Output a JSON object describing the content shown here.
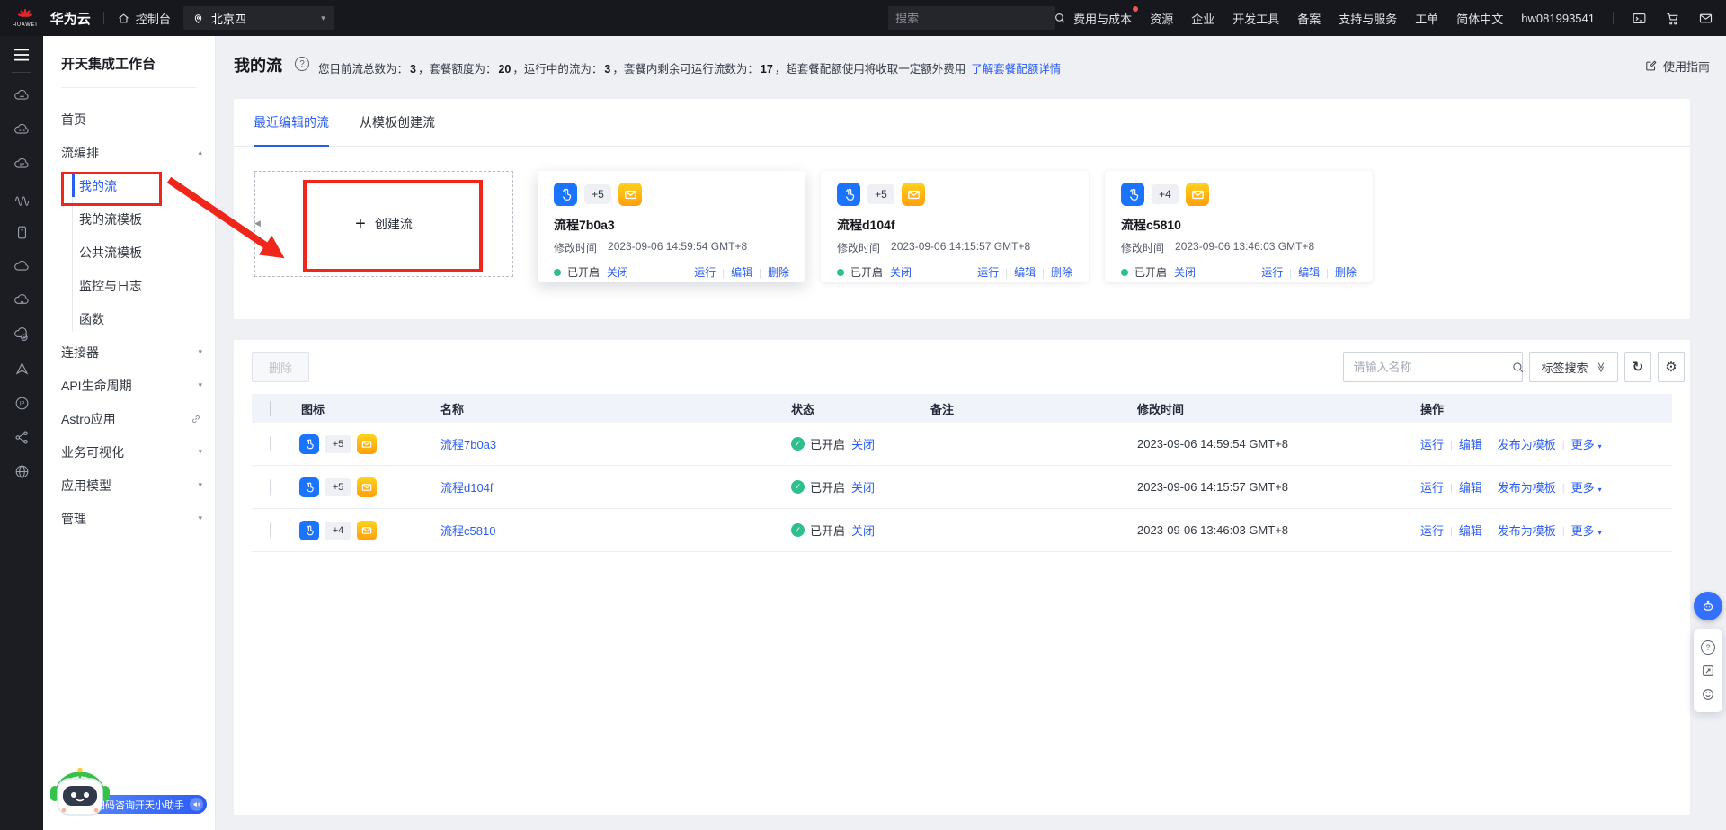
{
  "topnav": {
    "brand": "华为云",
    "console": "控制台",
    "region": "北京四",
    "search_placeholder": "搜索",
    "links": [
      {
        "label": "费用与成本",
        "badge": true
      },
      {
        "label": "资源"
      },
      {
        "label": "企业"
      },
      {
        "label": "开发工具"
      },
      {
        "label": "备案"
      },
      {
        "label": "支持与服务"
      },
      {
        "label": "工单"
      },
      {
        "label": "简体中文"
      }
    ],
    "username": "hw081993541"
  },
  "sidebar": {
    "title": "开天集成工作台",
    "home": "首页",
    "groups": {
      "flow": {
        "label": "流编排",
        "children": [
          {
            "label": "我的流",
            "active": true
          },
          {
            "label": "我的流模板"
          },
          {
            "label": "公共流模板"
          },
          {
            "label": "监控与日志"
          },
          {
            "label": "函数"
          }
        ]
      },
      "connector": "连接器",
      "api": "API生命周期",
      "astro": "Astro应用",
      "bizvis": "业务可视化",
      "appmodel": "应用模型",
      "manage": "管理"
    }
  },
  "page": {
    "title": "我的流",
    "desc": {
      "p1": "您目前流总数为：",
      "v1": "3",
      "p2": "，套餐额度为：",
      "v2": "20",
      "p3": "，运行中的流为：",
      "v3": "3",
      "p4": "，套餐内剩余可运行流数为：",
      "v4": "17",
      "p5": "，超套餐配额使用将收取一定额外费用",
      "link": "了解套餐配额详情"
    },
    "guide": "使用指南"
  },
  "tabs": {
    "recent": "最近编辑的流",
    "from_template": "从模板创建流"
  },
  "create_card": {
    "label": "创建流"
  },
  "cards": [
    {
      "name": "流程7b0a3",
      "badge": "+5",
      "modified_label": "修改时间",
      "modified": "2023-09-06 14:59:54 GMT+8",
      "status": "已开启",
      "toggle": "关闭",
      "run": "运行",
      "edit": "编辑",
      "del": "删除"
    },
    {
      "name": "流程d104f",
      "badge": "+5",
      "modified_label": "修改时间",
      "modified": "2023-09-06 14:15:57 GMT+8",
      "status": "已开启",
      "toggle": "关闭",
      "run": "运行",
      "edit": "编辑",
      "del": "删除"
    },
    {
      "name": "流程c5810",
      "badge": "+4",
      "modified_label": "修改时间",
      "modified": "2023-09-06 13:46:03 GMT+8",
      "status": "已开启",
      "toggle": "关闭",
      "run": "运行",
      "edit": "编辑",
      "del": "删除"
    }
  ],
  "table": {
    "delete_button": "删除",
    "search_placeholder": "请输入名称",
    "tag_search": "标签搜索",
    "columns": {
      "icon": "图标",
      "name": "名称",
      "status": "状态",
      "remark": "备注",
      "modified": "修改时间",
      "actions": "操作"
    },
    "rows": [
      {
        "badge": "+5",
        "name": "流程7b0a3",
        "status": "已开启",
        "toggle": "关闭",
        "remark": "",
        "modified": "2023-09-06 14:59:54 GMT+8",
        "run": "运行",
        "edit": "编辑",
        "publish": "发布为模板",
        "more": "更多"
      },
      {
        "badge": "+5",
        "name": "流程d104f",
        "status": "已开启",
        "toggle": "关闭",
        "remark": "",
        "modified": "2023-09-06 14:15:57 GMT+8",
        "run": "运行",
        "edit": "编辑",
        "publish": "发布为模板",
        "more": "更多"
      },
      {
        "badge": "+4",
        "name": "流程c5810",
        "status": "已开启",
        "toggle": "关闭",
        "remark": "",
        "modified": "2023-09-06 13:46:03 GMT+8",
        "run": "运行",
        "edit": "编辑",
        "publish": "发布为模板",
        "more": "更多"
      }
    ]
  },
  "assistant": {
    "label": "扫码咨询开天小助手"
  },
  "glyphs": {
    "caret_down": "▾",
    "caret_up": "▴",
    "collapse_left": "◀",
    "gear": "⚙",
    "refresh": "↻",
    "double_chevron": "≫",
    "check": "✓",
    "more_caret": "▾",
    "plus": "+",
    "help": "?"
  },
  "colors": {
    "accent": "#2a5cf4",
    "annotation_red": "#f0261a",
    "status_green": "#2fbe8e",
    "touch_icon_blue": "#1a74ff",
    "mail_icon_gradient": [
      "#ffd21c",
      "#ff9e0d"
    ],
    "topbar_bg": "#17181d",
    "page_bg": "#eef0f4",
    "table_header_bg": "#f0f3fa"
  }
}
